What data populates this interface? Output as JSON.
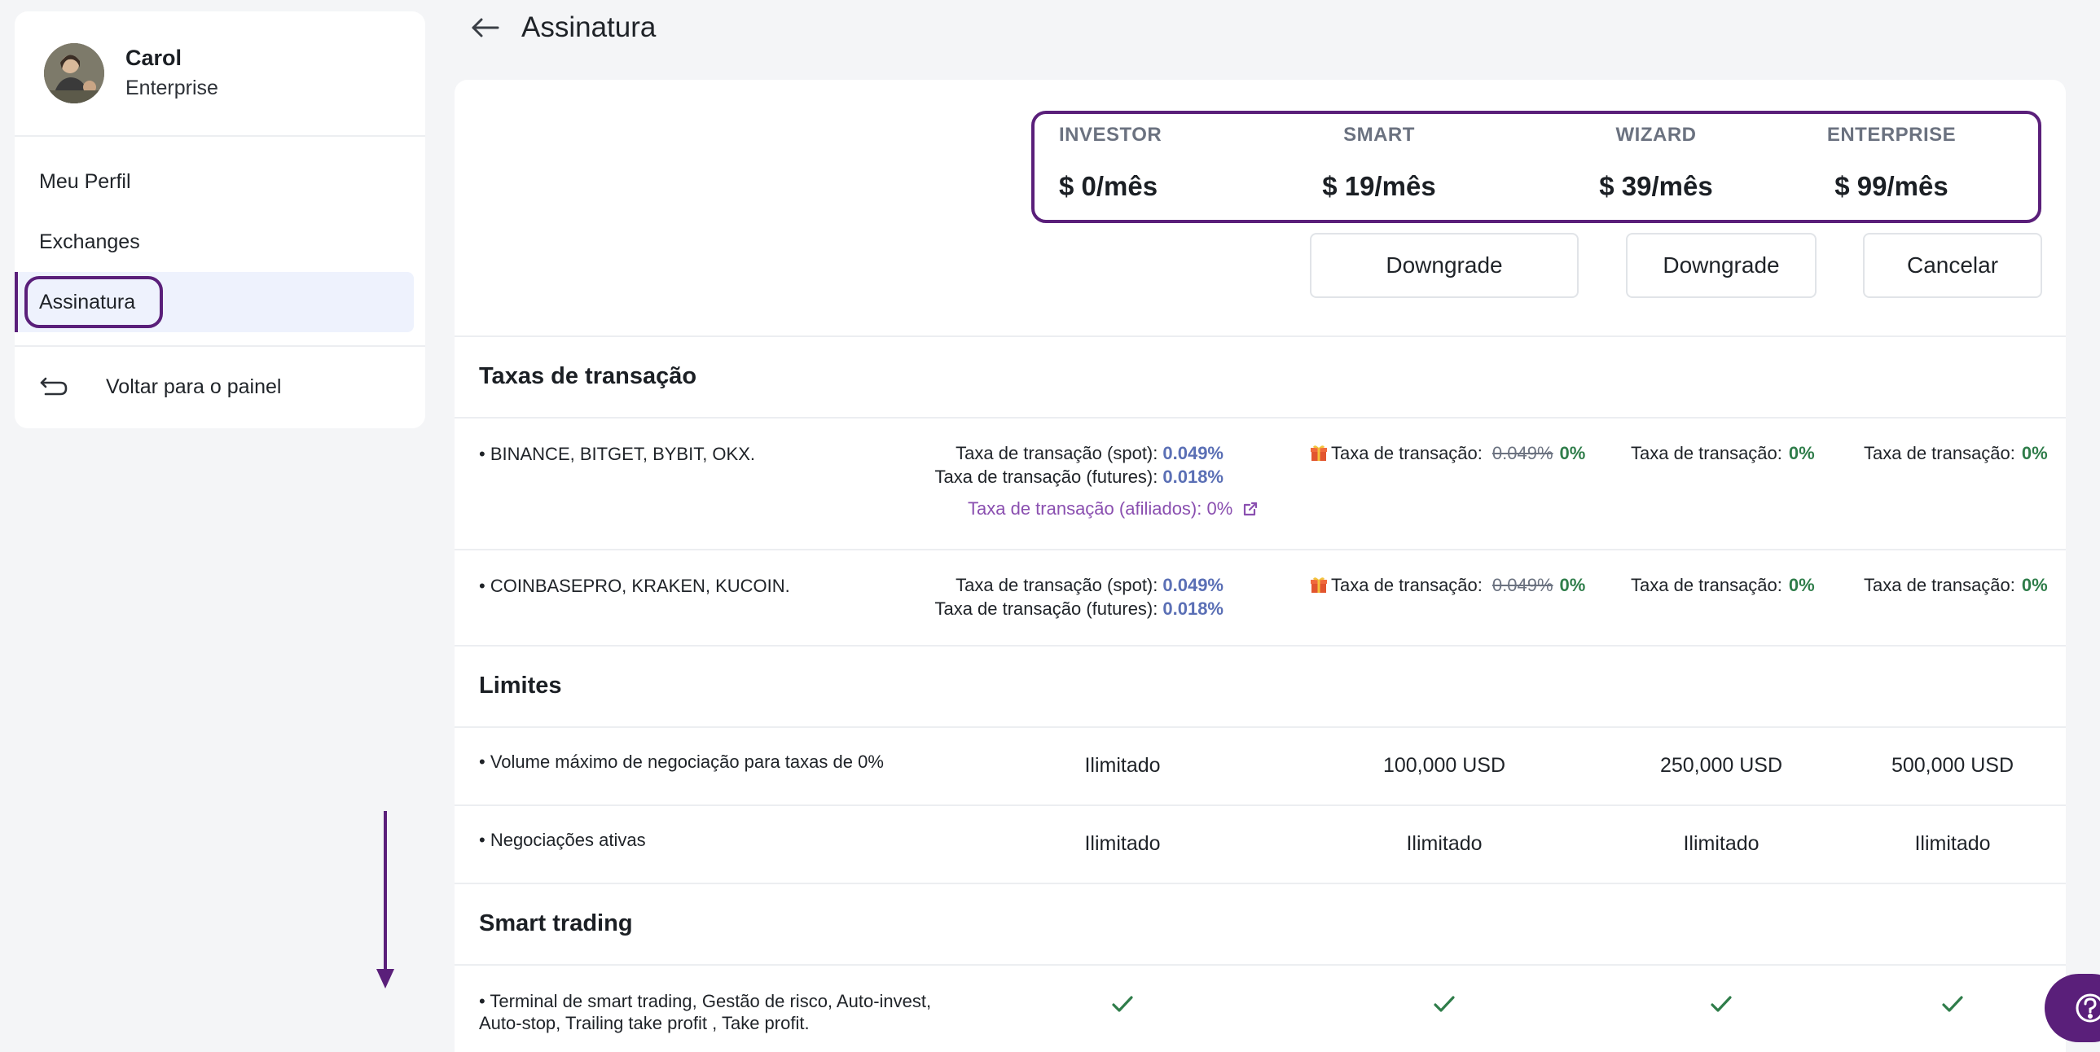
{
  "sidebar": {
    "user_name": "Carol",
    "user_plan": "Enterprise",
    "nav": [
      {
        "label": "Meu Perfil"
      },
      {
        "label": "Exchanges"
      },
      {
        "label": "Assinatura"
      }
    ],
    "back_label": "Voltar para o painel"
  },
  "header": {
    "title": "Assinatura"
  },
  "plans": [
    {
      "name": "INVESTOR",
      "price": "$ 0/mês"
    },
    {
      "name": "SMART",
      "price": "$ 19/mês",
      "button": "Downgrade"
    },
    {
      "name": "WIZARD",
      "price": "$ 39/mês",
      "button": "Downgrade"
    },
    {
      "name": "ENTERPRISE",
      "price": "$ 99/mês",
      "button": "Cancelar"
    }
  ],
  "sections": {
    "fees": {
      "title": "Taxas de transação",
      "rows": [
        {
          "feature": "• BINANCE, BITGET, BYBIT, OKX.",
          "investor": {
            "spot_label": "Taxa de transação (spot):",
            "spot_value": "0.049%",
            "futures_label": "Taxa de transação (futures):",
            "futures_value": "0.018%",
            "affiliate": "Taxa de transação (afiliados): 0%"
          },
          "smart": {
            "label": "Taxa de transação:",
            "old": "0.049%",
            "value": "0%"
          },
          "wizard": {
            "label": "Taxa de transação:",
            "value": "0%"
          },
          "enterprise": {
            "label": "Taxa de transação:",
            "value": "0%"
          }
        },
        {
          "feature": "• COINBASEPRO, KRAKEN, KUCOIN.",
          "investor": {
            "spot_label": "Taxa de transação (spot):",
            "spot_value": "0.049%",
            "futures_label": "Taxa de transação (futures):",
            "futures_value": "0.018%"
          },
          "smart": {
            "label": "Taxa de transação:",
            "old": "0.049%",
            "value": "0%"
          },
          "wizard": {
            "label": "Taxa de transação:",
            "value": "0%"
          },
          "enterprise": {
            "label": "Taxa de transação:",
            "value": "0%"
          }
        }
      ]
    },
    "limits": {
      "title": "Limites",
      "rows": [
        {
          "feature": "• Volume máximo de negociação para taxas de 0%",
          "values": [
            "Ilimitado",
            "100,000 USD",
            "250,000 USD",
            "500,000 USD"
          ]
        },
        {
          "feature": "• Negociações ativas",
          "values": [
            "Ilimitado",
            "Ilimitado",
            "Ilimitado",
            "Ilimitado"
          ]
        }
      ]
    },
    "smart_trading": {
      "title": "Smart trading",
      "rows": [
        {
          "feature_line1": "• Terminal de smart trading, Gestão de risco, Auto-invest,",
          "feature_line2": "Auto-stop, Trailing take profit , Take profit.",
          "included": [
            true,
            true,
            true,
            true
          ]
        }
      ]
    }
  },
  "colors": {
    "accent": "#5a1f7a",
    "fee_value": "#5a6fb5",
    "zero_fee": "#2f7d4a",
    "affiliate": "#8a4fb0",
    "active_nav_bg": "#eef2fd"
  },
  "icons": [
    "arrow-left-icon",
    "return-icon",
    "gift-icon",
    "external-link-icon",
    "check-icon",
    "help-icon"
  ]
}
